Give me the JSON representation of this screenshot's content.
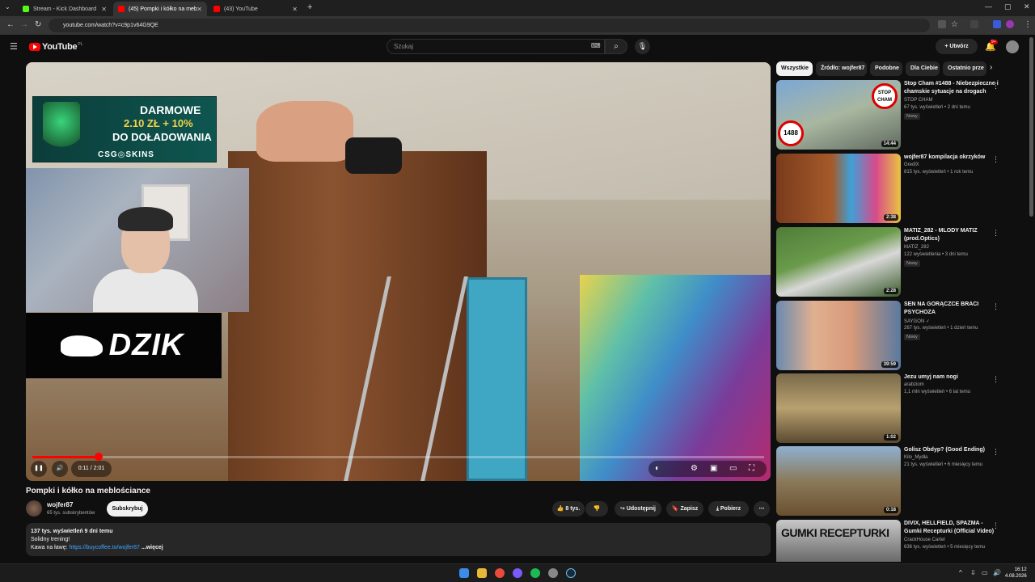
{
  "browser": {
    "tabs": [
      {
        "label": "Stream - Kick Dashboard",
        "color": "#53fc18"
      },
      {
        "label": "(45) Pompki i kółko na meb",
        "color": "#ff0000"
      },
      {
        "label": "(43) YouTube",
        "color": "#ff0000"
      }
    ],
    "url": "youtube.com/watch?v=c9p1v64G9QE"
  },
  "header": {
    "logo_text": "YouTube",
    "logo_country": "PL",
    "search_placeholder": "Szukaj",
    "create_label": "+ Utwórz",
    "notif_count": "9+"
  },
  "player": {
    "sponsor": {
      "line1": "DARMOWE",
      "line2": "2.10 ZŁ + 10%",
      "line3": "DO DOŁADOWANIA",
      "line4": "CSG◎SKINS"
    },
    "overlay_brand": "DZIK",
    "time": "0:11 / 2:01",
    "progress": 0.091
  },
  "video": {
    "title": "Pompki i kółko na meblościance",
    "channel": "wojfer87",
    "subs": "65 tys. subskrybentów",
    "subscribe_label": "Subskrybuj",
    "likes": "8 tys.",
    "share_label": "Udostępnij",
    "save_label": "Zapisz",
    "download_label": "Pobierz",
    "desc_stats": "137 tys. wyświetleń  9 dni temu",
    "desc_line1": "Solidny trening!",
    "desc_line2_prefix": "Kawa na ławę: ",
    "desc_link": "https://buycoffee.to/wojfer87",
    "desc_more": " ...więcej"
  },
  "chips": [
    "Wszystkie",
    "Źródło: wojfer87",
    "Podobne",
    "Dla Ciebie",
    "Ostatnio prze"
  ],
  "recommendations": [
    {
      "title": "Stop Cham #1488 - Niebezpieczne i chamskie sytuacje na drogach",
      "channel": "STOP CHAM",
      "meta": "67 tys. wyświetleń • 2 dni temu",
      "badge": "Nowy",
      "duration": "14:44"
    },
    {
      "title": "wojfer87 kompilacja okrzyków",
      "channel": "GredlX",
      "meta": "815 tys. wyświetleń • 1 rok temu",
      "badge": "",
      "duration": "2:38"
    },
    {
      "title": "MATIZ_282 - MLODY MATIZ (prod.Optics)",
      "channel": "MATIZ_282",
      "meta": "122 wyświetlenia • 3 dni temu",
      "badge": "Nowy",
      "duration": "2:28"
    },
    {
      "title": "SEN NA GORĄCZCE BRACI PSYCHOZA",
      "channel": "SAYGON ✓",
      "meta": "267 tys. wyświetleń • 1 dzień temu",
      "badge": "Nowy",
      "duration": "39:59"
    },
    {
      "title": "Jezu umyj nam nogi",
      "channel": "arabziom",
      "meta": "1,1 mln wyświetleń • 6 lat temu",
      "badge": "",
      "duration": "1:02"
    },
    {
      "title": "Golisz Obdyp? (Good Ending)",
      "channel": "Kilo_Mydła",
      "meta": "21 tys. wyświetleń • 6 miesięcy temu",
      "badge": "",
      "duration": "0:18"
    },
    {
      "title": "DIVIX, HELLFIELD, SPAZMA - Gumki Recepturki (Official Video)",
      "channel": "CrackHouse Cartel",
      "meta": "636 tys. wyświetleń • 5 miesięcy temu",
      "badge": "",
      "duration": ""
    }
  ],
  "rec_thumb_text": {
    "r0_sign": "STOP CHAM",
    "r0_num": "1488",
    "r6_text": "GUMKI RECEPTURKI"
  },
  "taskbar": {
    "time": "16:12",
    "date": "4.08.2026"
  }
}
